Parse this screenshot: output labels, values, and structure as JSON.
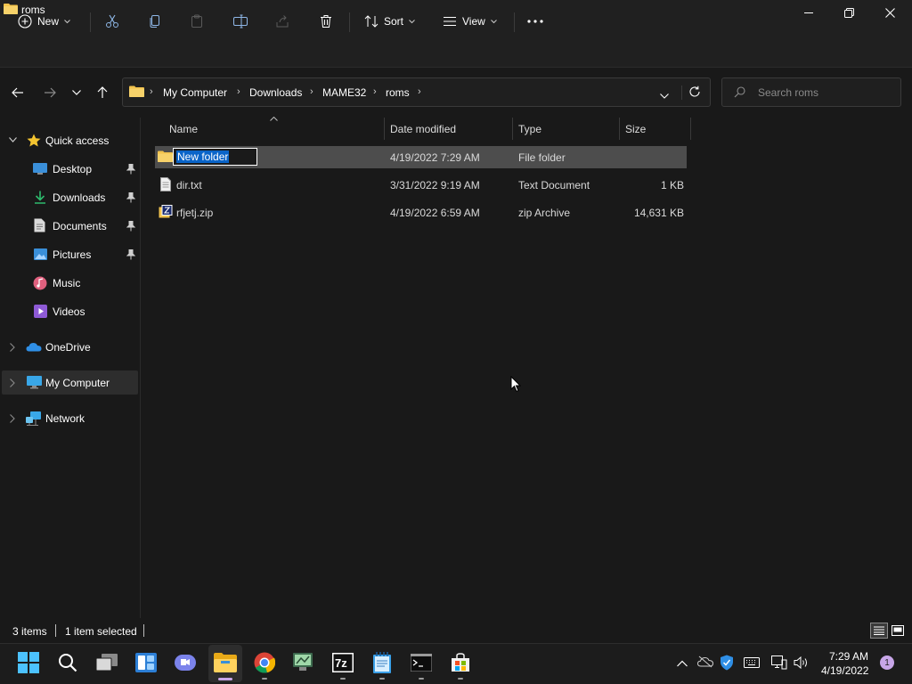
{
  "window": {
    "title": "roms"
  },
  "toolbar": {
    "new_label": "New",
    "sort_label": "Sort",
    "view_label": "View",
    "more_label": "..."
  },
  "address": {
    "crumbs": [
      "My Computer",
      "Downloads",
      "MAME32",
      "roms"
    ],
    "search_placeholder": "Search roms"
  },
  "sidebar": {
    "quick_access": "Quick access",
    "items": [
      {
        "label": "Desktop",
        "icon": "desktop-icon",
        "pinned": true
      },
      {
        "label": "Downloads",
        "icon": "download-icon",
        "pinned": true
      },
      {
        "label": "Documents",
        "icon": "documents-icon",
        "pinned": true
      },
      {
        "label": "Pictures",
        "icon": "pictures-icon",
        "pinned": true
      },
      {
        "label": "Music",
        "icon": "music-icon",
        "pinned": false
      },
      {
        "label": "Videos",
        "icon": "videos-icon",
        "pinned": false
      }
    ],
    "onedrive": "OneDrive",
    "my_computer": "My Computer",
    "network": "Network"
  },
  "columns": {
    "name": "Name",
    "date": "Date modified",
    "type": "Type",
    "size": "Size"
  },
  "files": [
    {
      "name": "New folder",
      "date": "4/19/2022 7:29 AM",
      "type": "File folder",
      "size": "",
      "selected": true,
      "renaming": true,
      "icon": "folder-icon"
    },
    {
      "name": "dir.txt",
      "date": "3/31/2022 9:19 AM",
      "type": "Text Document",
      "size": "1 KB",
      "selected": false,
      "icon": "text-file-icon"
    },
    {
      "name": "rfjetj.zip",
      "date": "4/19/2022 6:59 AM",
      "type": "zip Archive",
      "size": "14,631 KB",
      "selected": false,
      "icon": "zip-file-icon"
    }
  ],
  "status": {
    "count": "3 items",
    "selection": "1 item selected"
  },
  "taskbar": {
    "time": "7:29 AM",
    "date": "4/19/2022",
    "notifications": "1"
  },
  "colors": {
    "accent": "#0a64c8",
    "folder": "#f2c34d",
    "background": "#191919"
  }
}
